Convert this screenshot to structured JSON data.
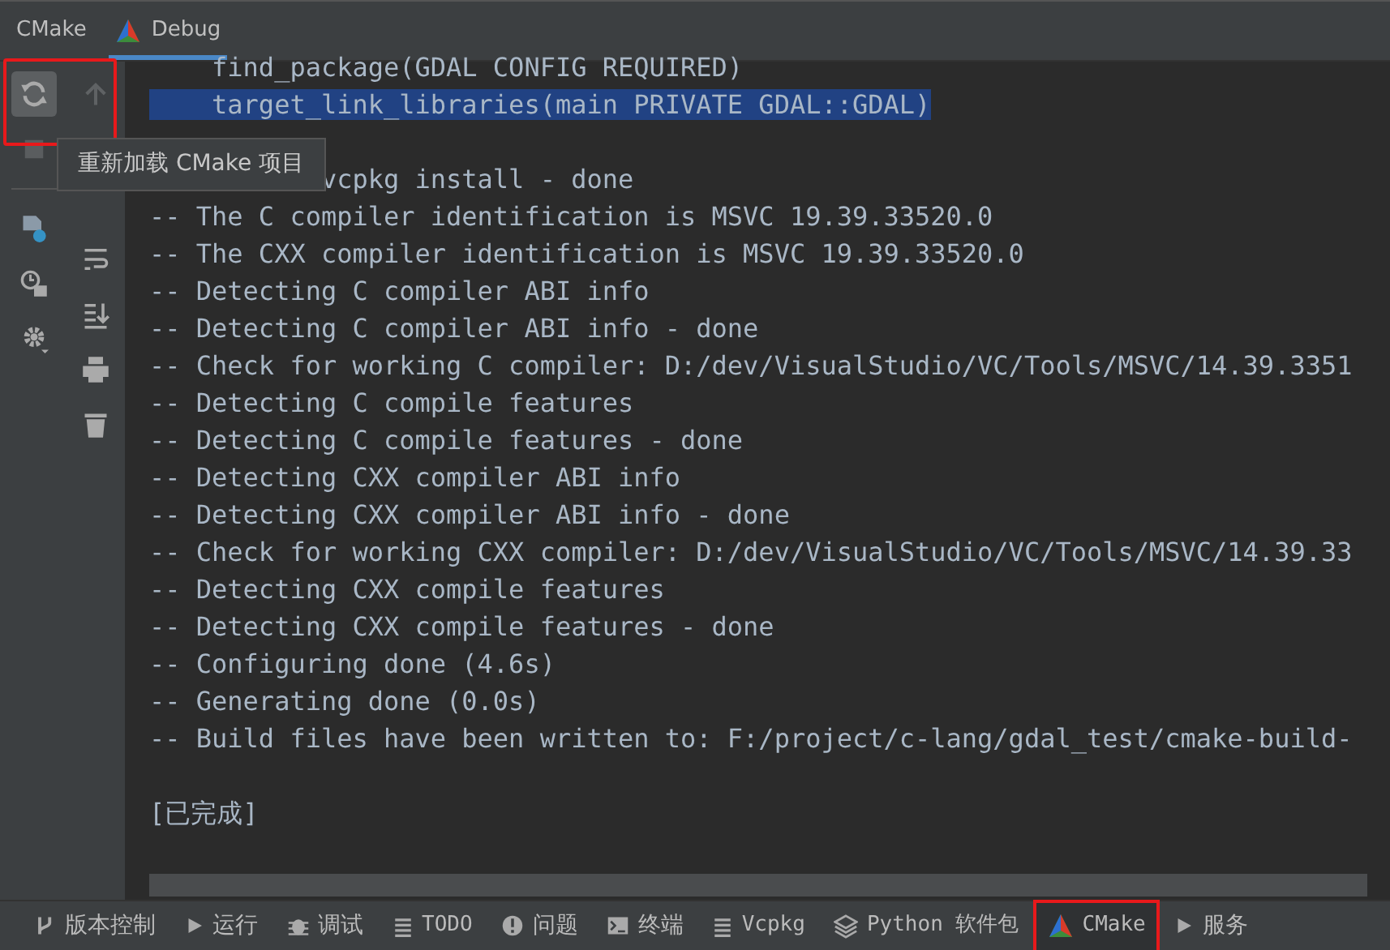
{
  "tabs": [
    {
      "label": "CMake",
      "kind": "plain",
      "selected": false
    },
    {
      "label": "Debug",
      "kind": "triangle",
      "selected": true
    }
  ],
  "left_toolbar": {
    "highlighted": true,
    "reload_selected": true,
    "up_disabled": true
  },
  "tooltip": "重新加载 CMake 项目",
  "console": {
    "lines": [
      {
        "text": "    find_package(GDAL CONFIG REQUIRED)",
        "selected": false
      },
      {
        "text": "    target_link_libraries(main PRIVATE GDAL::GDAL)",
        "selected": true
      },
      {
        "kind": "blank"
      },
      {
        "text": "vcpkg install - done",
        "kind": "partly_hidden",
        "selected": false
      },
      {
        "text": "-- The C compiler identification is MSVC 19.39.33520.0",
        "selected": false
      },
      {
        "text": "-- The CXX compiler identification is MSVC 19.39.33520.0",
        "selected": false
      },
      {
        "text": "-- Detecting C compiler ABI info",
        "selected": false
      },
      {
        "text": "-- Detecting C compiler ABI info - done",
        "selected": false
      },
      {
        "text": "-- Check for working C compiler: D:/dev/VisualStudio/VC/Tools/MSVC/14.39.3351",
        "selected": false
      },
      {
        "text": "-- Detecting C compile features",
        "selected": false
      },
      {
        "text": "-- Detecting C compile features - done",
        "selected": false
      },
      {
        "text": "-- Detecting CXX compiler ABI info",
        "selected": false
      },
      {
        "text": "-- Detecting CXX compiler ABI info - done",
        "selected": false
      },
      {
        "text": "-- Check for working CXX compiler: D:/dev/VisualStudio/VC/Tools/MSVC/14.39.33",
        "selected": false
      },
      {
        "text": "-- Detecting CXX compile features",
        "selected": false
      },
      {
        "text": "-- Detecting CXX compile features - done",
        "selected": false
      },
      {
        "text": "-- Configuring done (4.6s)",
        "selected": false
      },
      {
        "text": "-- Generating done (0.0s)",
        "selected": false
      },
      {
        "text": "-- Build files have been written to: F:/project/c-lang/gdal_test/cmake-build-",
        "selected": false
      },
      {
        "kind": "blank"
      },
      {
        "text": "[已完成]",
        "selected": false
      }
    ]
  },
  "bottom_tabs": [
    {
      "label": "版本控制",
      "kind": "branch",
      "selected": false,
      "highlighted": false
    },
    {
      "label": "运行",
      "kind": "play",
      "selected": false,
      "highlighted": false
    },
    {
      "label": "调试",
      "kind": "bug",
      "selected": false,
      "highlighted": false
    },
    {
      "label": "TODO",
      "kind": "list",
      "selected": false,
      "highlighted": false
    },
    {
      "label": "问题",
      "kind": "alert",
      "selected": false,
      "highlighted": false
    },
    {
      "label": "终端",
      "kind": "terminal",
      "selected": false,
      "highlighted": false
    },
    {
      "label": "Vcpkg",
      "kind": "list",
      "selected": false,
      "highlighted": false
    },
    {
      "label": "Python 软件包",
      "kind": "layers",
      "selected": false,
      "highlighted": false
    },
    {
      "label": "CMake",
      "kind": "triangle",
      "selected": true,
      "highlighted": true
    },
    {
      "label": "服务",
      "kind": "play",
      "selected": false,
      "highlighted": false
    }
  ]
}
